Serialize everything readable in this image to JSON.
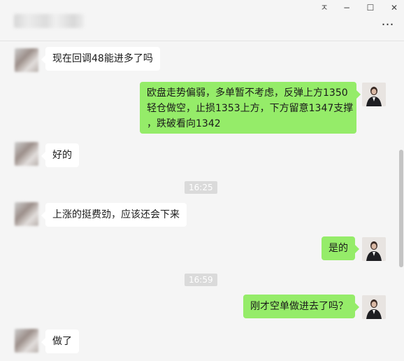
{
  "window": {
    "controls": {
      "pin": "ㅈ",
      "minimize": "−",
      "maximize": "☐",
      "close": "✕"
    },
    "more_label": "…"
  },
  "messages": [
    {
      "side": "left",
      "text": "现在回调48能进多了吗"
    },
    {
      "side": "right",
      "lines": [
        "欧盘走势偏弱，多单暂不考虑，反弹上方1350",
        "轻仓做空，止损1353上方，下方留意1347支撑",
        "，跌破看向1342"
      ]
    },
    {
      "side": "left",
      "text": "好的"
    },
    {
      "side": "time",
      "text": "16:25"
    },
    {
      "side": "left",
      "text": "上涨的挺费劲，应该还会下来"
    },
    {
      "side": "right",
      "text": "是的"
    },
    {
      "side": "time",
      "text": "16:59"
    },
    {
      "side": "right",
      "text": "刚才空单做进去了吗？"
    },
    {
      "side": "left",
      "text": "做了"
    }
  ],
  "colors": {
    "self_bubble": "#95ec69",
    "other_bubble": "#ffffff",
    "background": "#f5f5f5"
  }
}
